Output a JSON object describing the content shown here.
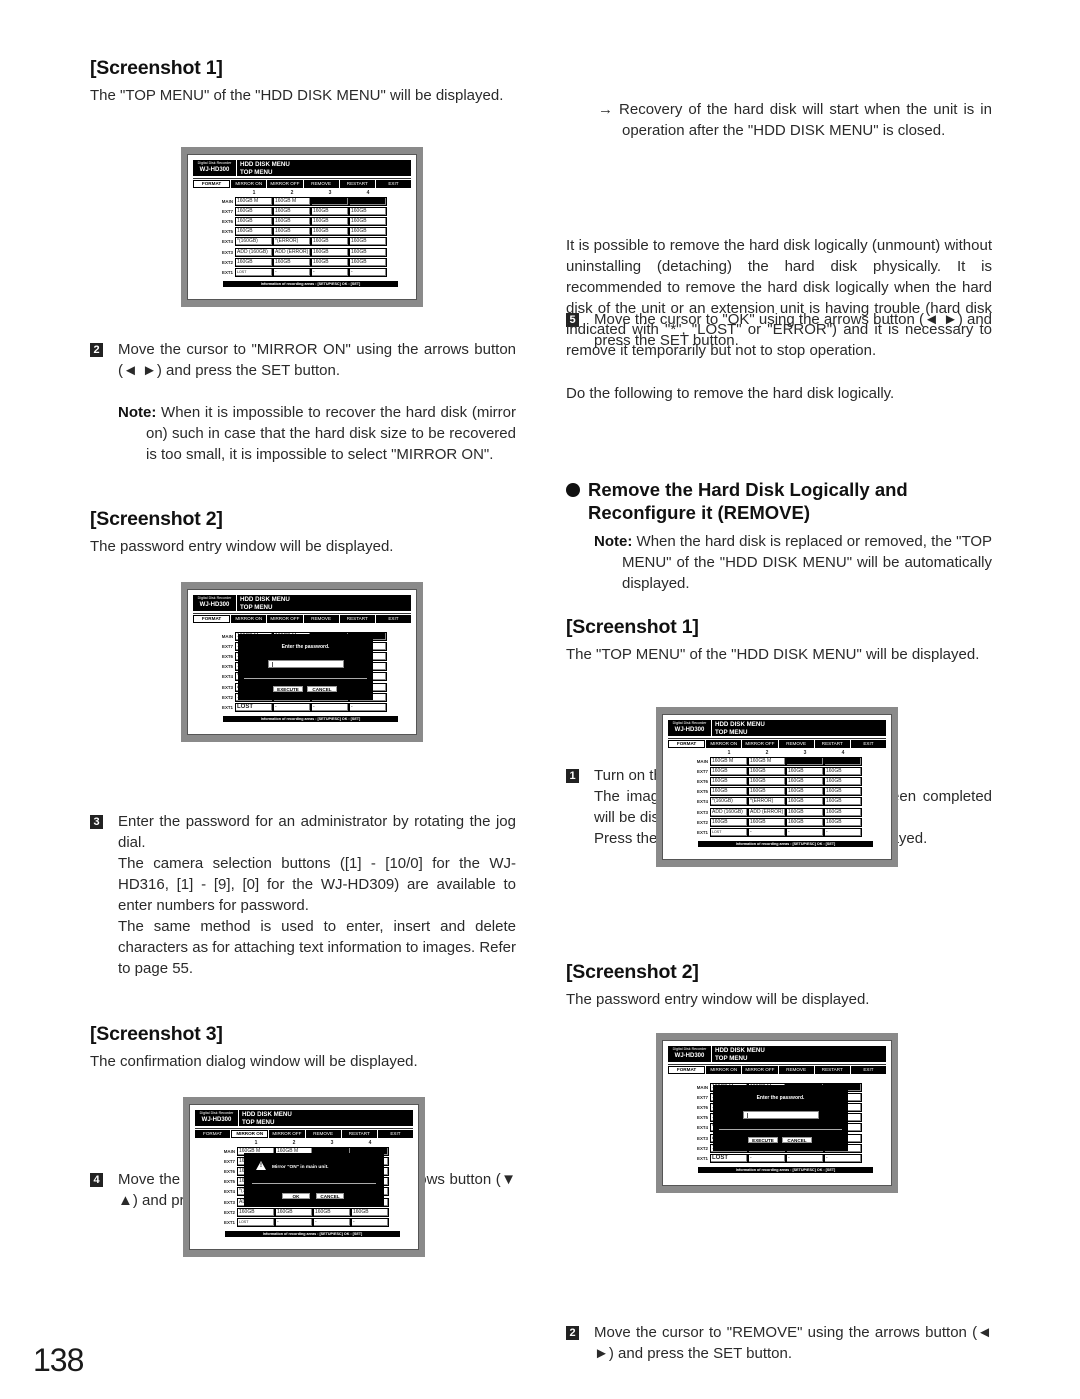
{
  "page_number": "138",
  "screen_common": {
    "brand_small": "Digital Disk Recorder",
    "model": "WJ-HD300",
    "title_line1": "HDD DISK MENU",
    "title_line2": "TOP MENU",
    "menu": [
      "FORMAT",
      "MIRROR ON",
      "MIRROR OFF",
      "REMOVE",
      "RESTART",
      "EXIT"
    ],
    "columns": [
      "1",
      "2",
      "3",
      "4"
    ],
    "rows": [
      {
        "label": "MAIN",
        "cells": [
          "160GB M",
          "160GB M",
          "",
          ""
        ]
      },
      {
        "label": "EXT7",
        "cells": [
          "160GB",
          "160GB",
          "160GB",
          "160GB"
        ]
      },
      {
        "label": "EXT6",
        "cells": [
          "160GB",
          "160GB",
          "160GB",
          "160GB"
        ]
      },
      {
        "label": "EXT5",
        "cells": [
          "160GB",
          "160GB",
          "160GB",
          "160GB"
        ]
      },
      {
        "label": "EXT4",
        "cells": [
          "*(160GB)",
          "*(ERROR)",
          "160GB",
          "160GB"
        ]
      },
      {
        "label": "EXT3",
        "cells": [
          "ADD (160GB)",
          "ADD (ERROR)",
          "160GB",
          "160GB"
        ]
      },
      {
        "label": "EXT2",
        "cells": [
          "160GB",
          "160GB",
          "160GB",
          "160GB"
        ]
      },
      {
        "label": "EXT1",
        "cells": [
          "LOST",
          "-",
          "-",
          "-"
        ]
      }
    ],
    "info_bar": "Information of recording areas : [SETUP/ESC] OK : [SET]"
  },
  "password_dialog": {
    "prompt": "Enter the password.",
    "input_value": "",
    "execute_label": "EXECUTE",
    "cancel_label": "CANCEL",
    "ext1_first_cell": "LOST"
  },
  "confirm_dialog": {
    "message": "Mirror \"ON\" in main unit.",
    "ok_label": "OK",
    "cancel_label": "CANCEL"
  },
  "left": {
    "shot1_heading": "[Screenshot 1]",
    "shot1_text": "The \"TOP MENU\" of the \"HDD DISK MENU\" will be displayed.",
    "step2_num": "2",
    "step2_text": "Move the cursor to \"MIRROR ON\" using the arrows button (◄ ►) and press the SET button.",
    "note1_label": "Note:",
    "note1_text": "When it is impossible to recover the hard disk (mirror on) such in case that the hard disk size to be recovered is too small, it is impossible to select \"MIRROR ON\".",
    "shot2_heading": "[Screenshot 2]",
    "shot2_text": "The password entry window will be displayed.",
    "step3_num": "3",
    "step3_text": "Enter the password for an administrator by rotating the jog dial.",
    "step3_text2": "The camera selection buttons ([1] - [10/0] for the WJ-HD316, [1] - [9], [0] for the WJ-HD309) are available to enter numbers for password.",
    "step3_text3": "The same method is used to enter, insert and delete characters as for attaching text information to images. Refer to page 55.",
    "step4_num": "4",
    "step4_text": "Move the cursor to \"EXECUTE\" using the arrows button (▼ ▲) and press the SET button.",
    "shot3_heading": "[Screenshot 3]",
    "shot3_text": "The confirmation dialog window will be displayed."
  },
  "right": {
    "step5_num": "5",
    "step5_text": "Move the cursor to \"OK\" using the arrows button (◄ ►) and press the SET button.",
    "step5_result": "→ Recovery of the hard disk will start when the unit is in operation after the \"HDD DISK MENU\" is closed.",
    "section_title_line1": "Remove the Hard Disk Logically and",
    "section_title_line2": "Reconfigure it (REMOVE)",
    "intro": "It is possible to remove the hard disk logically (unmount) without uninstalling (detaching) the hard disk physically. It is recommended to remove the hard disk logically when the hard disk of the unit or an extension unit is having trouble (hard disk indicated with \"*\", \"LOST\" or \"ERROR\") and it is necessary to remove it temporarily but not to stop operation.",
    "intro2": "Do the following to remove the hard disk logically.",
    "step1_num": "1",
    "step1_text": "Turn on the power of this unit.",
    "step1_text2": "The image saying the system check has been completed will be displayed.",
    "step1_text3": "Press the SET button after the image is displayed.",
    "note_label": "Note:",
    "note_text": "When the hard disk is replaced or removed, the \"TOP MENU\" of the \"HDD DISK MENU\" will be automatically displayed.",
    "shot1_heading": "[Screenshot 1]",
    "shot1_text": "The \"TOP MENU\" of the \"HDD DISK MENU\" will be displayed.",
    "step2_num": "2",
    "step2_text": "Move the cursor to \"REMOVE\" using the arrows button (◄ ►) and press the SET button.",
    "shot2_heading": "[Screenshot 2]",
    "shot2_text": "The password entry window will be displayed."
  }
}
